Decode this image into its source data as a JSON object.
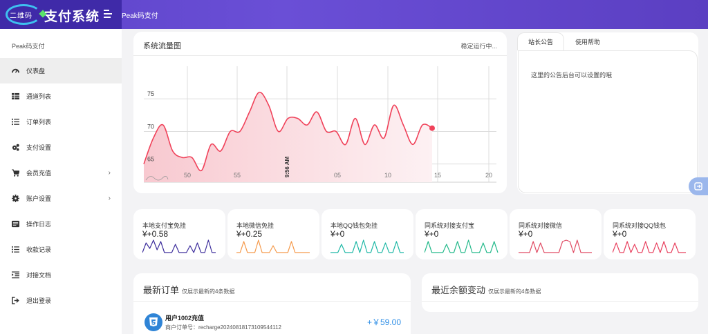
{
  "header": {
    "logo_small_text": "二维码",
    "logo_text": "支付系统",
    "title": "Peak码支付"
  },
  "sidebar": {
    "brand": "Peak码支付",
    "items": [
      {
        "label": "仪表盘",
        "icon": "dashboard-icon",
        "active": true
      },
      {
        "label": "通道列表",
        "icon": "table-icon"
      },
      {
        "label": "订单列表",
        "icon": "list-icon"
      },
      {
        "label": "支付设置",
        "icon": "cogs-icon"
      },
      {
        "label": "会员充值",
        "icon": "cart-icon",
        "has_submenu": true
      },
      {
        "label": "账户设置",
        "icon": "gear-icon",
        "has_submenu": true
      },
      {
        "label": "操作日志",
        "icon": "log-icon"
      },
      {
        "label": "收款记录",
        "icon": "list-icon"
      },
      {
        "label": "对接文档",
        "icon": "indent-icon"
      },
      {
        "label": "退出登录",
        "icon": "sign-out-icon"
      }
    ],
    "chevron": "›"
  },
  "traffic_chart": {
    "title": "系统流量图",
    "status": "稳定运行中..."
  },
  "notice": {
    "tabs": [
      "站长公告",
      "使用帮助"
    ],
    "content": "这里的公告后台可以设置的哦"
  },
  "stats": [
    {
      "label": "本地支付宝免挂",
      "value": "¥+0.58",
      "color": "#3d2e9c"
    },
    {
      "label": "本地微信免挂",
      "value": "¥+0.25",
      "color": "#f59a4c"
    },
    {
      "label": "本地QQ钱包免挂",
      "value": "¥+0",
      "color": "#1fb8a6"
    },
    {
      "label": "同系统对接支付宝",
      "value": "¥+0",
      "color": "#23b98a"
    },
    {
      "label": "同系统对接微信",
      "value": "¥+0",
      "color": "#e04b63"
    },
    {
      "label": "同系统对接QQ钱包",
      "value": "¥+0",
      "color": "#e8405e"
    }
  ],
  "orders": {
    "title": "最新订单",
    "subtitle": "仅展示最新的4条数据",
    "items": [
      {
        "name": "用户1002充值",
        "order_no": "商户订单号：recharge20240818173109544112",
        "amount": "+￥59.00"
      }
    ]
  },
  "balance": {
    "title": "最近余额变动",
    "subtitle": "仅展示最新的4条数据"
  },
  "chart_data": {
    "type": "area",
    "title": "系统流量图",
    "x_tick_labels": [
      "50",
      "55",
      "9:56 AM",
      "05",
      "10",
      "15",
      "20"
    ],
    "y_tick_labels": [
      "65",
      "70",
      "75"
    ],
    "ylim": [
      62,
      80
    ],
    "series": [
      {
        "color": "#f0425a",
        "x": [
          0,
          1,
          2,
          3,
          4,
          5,
          6,
          7,
          8,
          9,
          10,
          11,
          12,
          13,
          14,
          15,
          16,
          17,
          18,
          19,
          20,
          21,
          22,
          23,
          24,
          25,
          26,
          27,
          28,
          29,
          30
        ],
        "y": [
          65,
          69,
          71,
          67,
          66,
          66,
          64,
          68,
          67,
          70,
          70,
          73,
          76,
          74,
          70,
          72,
          72,
          71,
          73,
          70,
          70,
          68,
          72,
          68,
          71,
          69,
          74,
          71,
          68,
          71,
          70.5
        ]
      }
    ],
    "grid": true,
    "last_point_marker": true
  }
}
